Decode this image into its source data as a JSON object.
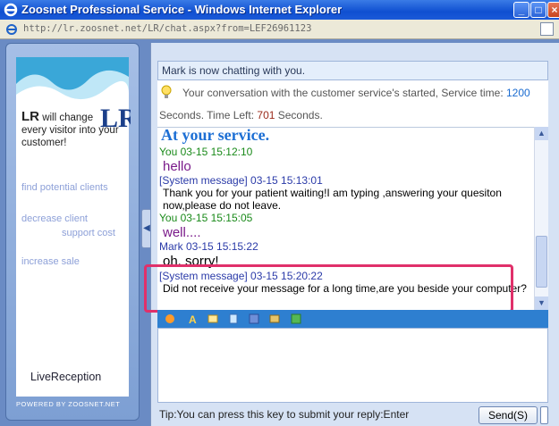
{
  "window": {
    "title": "Zoosnet Professional Service - Windows Internet Explorer",
    "url": "http://lr.zoosnet.net/LR/chat.aspx?from=LEF26961123"
  },
  "sidebar": {
    "brand_lr": "LR",
    "slogan_rest": " will change every visitor into your customer!",
    "features": [
      "find potential clients",
      "decrease client",
      "support cost",
      "increase sale"
    ],
    "brand_name": "LiveReception",
    "powered": "POWERED BY ZOOSNET.NET"
  },
  "status": {
    "text": "Mark is now chatting with you."
  },
  "info": {
    "line1_prefix": "Your conversation with the customer service's started, Service time: ",
    "service_time": "1200",
    "line2_a": "Seconds. Time Left: ",
    "time_left": "701",
    "line2_b": " Seconds."
  },
  "chat": {
    "top_line": "At your service.",
    "messages": [
      {
        "header": "You 03-15 15:12:10",
        "body": "hello"
      },
      {
        "header": "[System message] 03-15 15:13:01",
        "body": "Thank you for your patient waiting!I am typing ,answering your quesiton now,please do not leave."
      },
      {
        "header": "You 03-15 15:15:05",
        "body": "well...."
      },
      {
        "header": "Mark 03-15 15:15:22",
        "body": "oh, sorry!"
      },
      {
        "header": "[System message] 03-15 15:20:22",
        "body": "Did not receive your message for a long time,are you beside your computer?"
      }
    ]
  },
  "footer": {
    "tip": "Tip:You can press this key to submit your reply:Enter",
    "send_label": "Send(S)"
  }
}
